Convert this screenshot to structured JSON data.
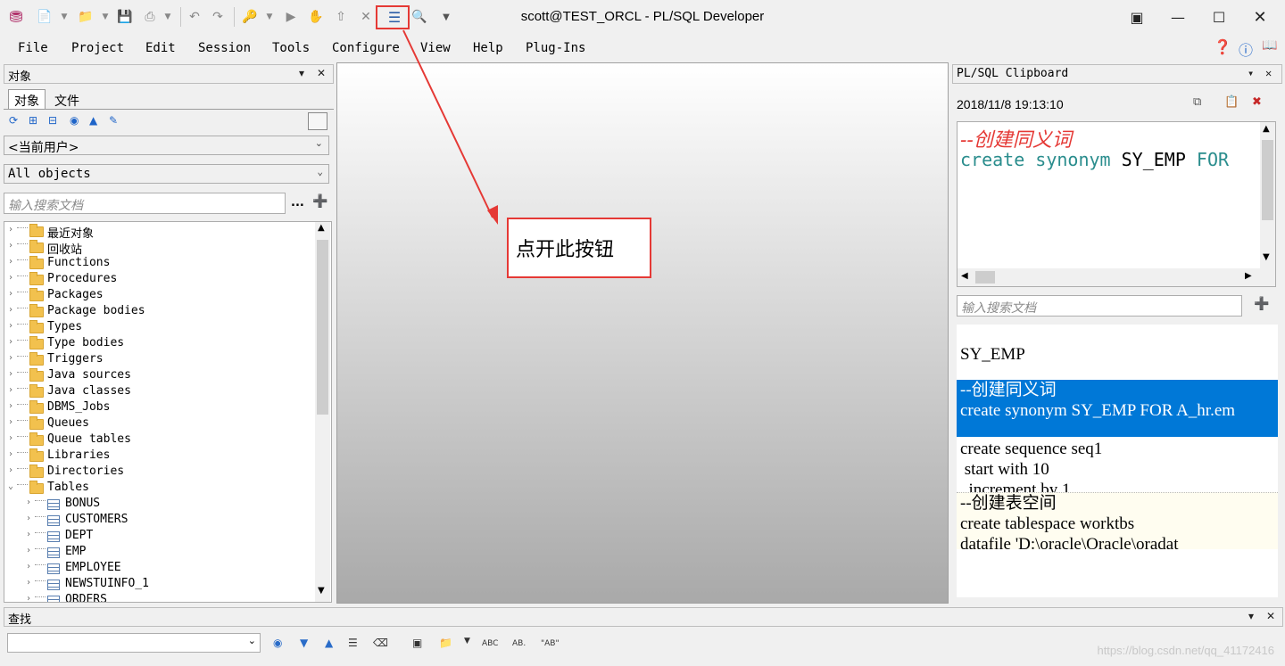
{
  "window": {
    "title": "scott@TEST_ORCL - PL/SQL Developer"
  },
  "menu": [
    "File",
    "Project",
    "Edit",
    "Session",
    "Tools",
    "Configure",
    "View",
    "Help",
    "Plug-Ins"
  ],
  "objects_panel": {
    "title": "对象",
    "tabs": [
      "对象",
      "文件"
    ],
    "user_select": "<当前用户>",
    "filter_select": "All objects",
    "search_placeholder": "输入搜索文档",
    "search_more": "...",
    "tree": [
      {
        "label": "最近对象",
        "type": "folder",
        "level": 0
      },
      {
        "label": "回收站",
        "type": "folder",
        "level": 0
      },
      {
        "label": "Functions",
        "type": "folder",
        "level": 0
      },
      {
        "label": "Procedures",
        "type": "folder",
        "level": 0
      },
      {
        "label": "Packages",
        "type": "folder",
        "level": 0
      },
      {
        "label": "Package bodies",
        "type": "folder",
        "level": 0
      },
      {
        "label": "Types",
        "type": "folder",
        "level": 0
      },
      {
        "label": "Type bodies",
        "type": "folder",
        "level": 0
      },
      {
        "label": "Triggers",
        "type": "folder",
        "level": 0
      },
      {
        "label": "Java sources",
        "type": "folder",
        "level": 0
      },
      {
        "label": "Java classes",
        "type": "folder",
        "level": 0
      },
      {
        "label": "DBMS_Jobs",
        "type": "folder",
        "level": 0
      },
      {
        "label": "Queues",
        "type": "folder",
        "level": 0
      },
      {
        "label": "Queue tables",
        "type": "folder",
        "level": 0
      },
      {
        "label": "Libraries",
        "type": "folder",
        "level": 0
      },
      {
        "label": "Directories",
        "type": "folder",
        "level": 0
      },
      {
        "label": "Tables",
        "type": "folder-open",
        "level": 0
      },
      {
        "label": "BONUS",
        "type": "table",
        "level": 1
      },
      {
        "label": "CUSTOMERS",
        "type": "table",
        "level": 1
      },
      {
        "label": "DEPT",
        "type": "table",
        "level": 1
      },
      {
        "label": "EMP",
        "type": "table",
        "level": 1
      },
      {
        "label": "EMPLOYEE",
        "type": "table",
        "level": 1
      },
      {
        "label": "NEWSTUINFO_1",
        "type": "table",
        "level": 1
      },
      {
        "label": "ORDERS",
        "type": "table",
        "level": 1
      }
    ]
  },
  "annotation": {
    "callout_text": "点开此按钮"
  },
  "clipboard_panel": {
    "title": "PL/SQL Clipboard",
    "timestamp": "2018/11/8 19:13:10",
    "preview_comment": "--创建同义词",
    "preview_code_kw1": "create synonym",
    "preview_code_name": "SY_EMP",
    "preview_code_kw2": "FOR",
    "search_placeholder": "输入搜索文档",
    "items": [
      {
        "lines": [
          "SY_EMP"
        ],
        "selected": false
      },
      {
        "lines": [
          "--创建同义词",
          "create synonym SY_EMP FOR A_hr.em"
        ],
        "selected": true
      },
      {
        "lines": [
          "create sequence seq1",
          " start with 10",
          "  increment by 1"
        ],
        "selected": false
      },
      {
        "lines": [
          "--创建表空间",
          "create tablespace worktbs",
          "datafile 'D:\\oracle\\Oracle\\oradat"
        ],
        "selected": false
      }
    ]
  },
  "find_panel": {
    "title": "查找",
    "input_value": ""
  },
  "watermark": "https://blog.csdn.net/qq_41172416",
  "colors": {
    "accent_red": "#e53935",
    "selection_blue": "#0078d7",
    "keyword_teal": "#2a8d8d",
    "comment_red": "#e53935"
  }
}
